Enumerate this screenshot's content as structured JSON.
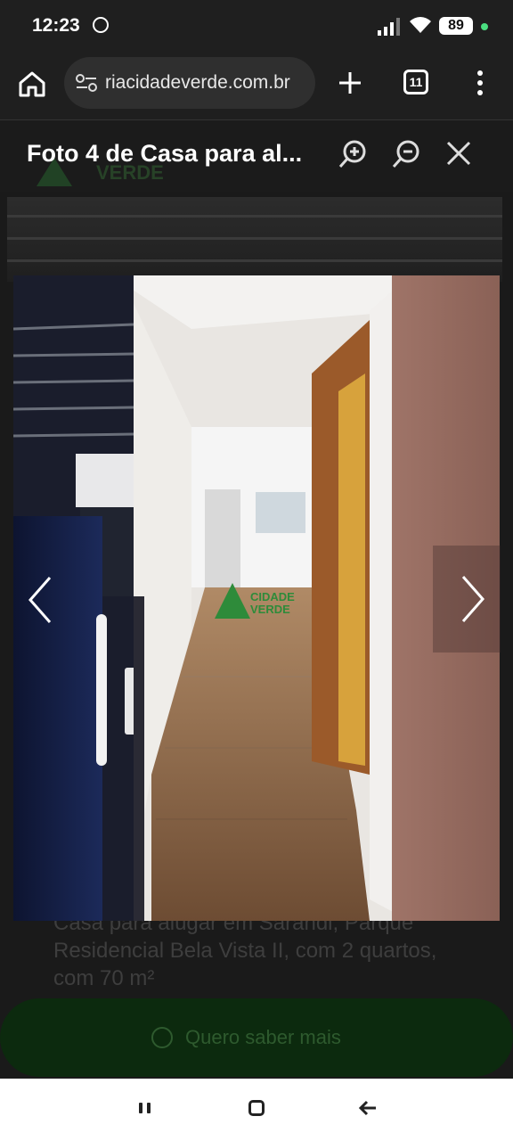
{
  "status_bar": {
    "time": "12:23",
    "battery": "89"
  },
  "browser": {
    "url": "riacidadeverde.com.br",
    "tab_count": "11"
  },
  "lightbox": {
    "title": "Foto 4 de Casa para al...",
    "watermark_top": "CIDADE",
    "watermark_bottom": "VERDE"
  },
  "page": {
    "listing_text": "Casa para alugar em Sarandi, Parque Residencial Bela Vista II, com 2 quartos, com 70 m²",
    "cta_label": "Quero saber mais",
    "ghost_logo_word": "VERDE"
  },
  "colors": {
    "brand_green": "#2e8b3a",
    "cta_dark": "#0c2a0e"
  }
}
